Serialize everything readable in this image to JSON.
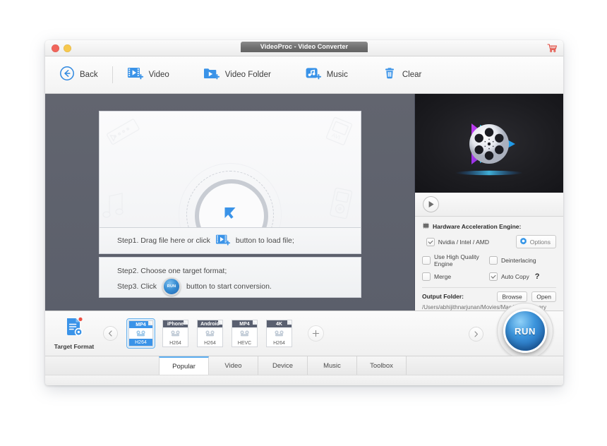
{
  "window": {
    "title": "VideoProc - Video Converter",
    "traffic_close": "close-button",
    "traffic_minimize": "minimize-button",
    "cart_icon": "shopping-cart-icon"
  },
  "toolbar": {
    "back": "Back",
    "video": "Video",
    "video_folder": "Video Folder",
    "music": "Music",
    "clear": "Clear"
  },
  "dropzone": {
    "cursor_icon": "drag-cursor-icon",
    "step1_prefix": "Step1. Drag file here or click",
    "step1_suffix": "button to load file;",
    "step2": "Step2. Choose one target format;",
    "step3_prefix": "Step3. Click",
    "step3_suffix": "button to start conversion.",
    "run_mini_label": "RUN"
  },
  "preview": {
    "logo_alt": "videoproc-film-reel-logo",
    "play_icon": "play-icon"
  },
  "settings": {
    "hw_title": "Hardware Acceleration Engine:",
    "hw_icon": "chip-icon",
    "nvidia": {
      "label": "Nvidia / Intel / AMD",
      "checked": true
    },
    "options_button": "Options",
    "options_icon": "gear-icon",
    "high_quality": {
      "label": "Use High Quality Engine",
      "checked": false
    },
    "deinterlacing": {
      "label": "Deinterlacing",
      "checked": false
    },
    "merge": {
      "label": "Merge",
      "checked": false
    },
    "auto_copy": {
      "label": "Auto Copy",
      "checked": true
    },
    "help_mark": "?",
    "output_label": "Output Folder:",
    "browse_button": "Browse",
    "open_button": "Open",
    "output_path": "/Users/abhijithnarjunan/Movies/Mac Video Library"
  },
  "format_strip": {
    "target_format_label": "Target Format",
    "target_format_icon": "document-settings-icon",
    "prev_icon": "chevron-left-icon",
    "next_icon": "chevron-right-icon",
    "add_icon": "plus-icon",
    "cards": [
      {
        "top": "MP4",
        "bottom": "H264",
        "selected": true
      },
      {
        "top": "iPhone",
        "bottom": "H264",
        "selected": false
      },
      {
        "top": "Android",
        "bottom": "H264",
        "selected": false
      },
      {
        "top": "MP4",
        "bottom": "HEVC",
        "selected": false
      },
      {
        "top": "4K",
        "bottom": "H264",
        "selected": false
      }
    ],
    "run_label": "RUN"
  },
  "tabs": [
    {
      "label": "Popular",
      "active": true
    },
    {
      "label": "Video",
      "active": false
    },
    {
      "label": "Device",
      "active": false
    },
    {
      "label": "Music",
      "active": false
    },
    {
      "label": "Toolbox",
      "active": false
    }
  ],
  "colors": {
    "accent_blue": "#3a93e8",
    "canvas_dark": "#5e6270",
    "tab_active_border": "#5aadf0",
    "title_pill": "#6f6f6f"
  }
}
